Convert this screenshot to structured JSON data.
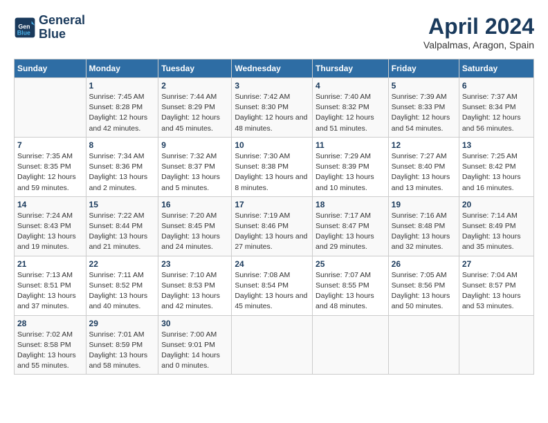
{
  "header": {
    "logo_line1": "General",
    "logo_line2": "Blue",
    "title": "April 2024",
    "subtitle": "Valpalmas, Aragon, Spain"
  },
  "columns": [
    "Sunday",
    "Monday",
    "Tuesday",
    "Wednesday",
    "Thursday",
    "Friday",
    "Saturday"
  ],
  "weeks": [
    [
      {
        "day": "",
        "sunrise": "",
        "sunset": "",
        "daylight": ""
      },
      {
        "day": "1",
        "sunrise": "Sunrise: 7:45 AM",
        "sunset": "Sunset: 8:28 PM",
        "daylight": "Daylight: 12 hours and 42 minutes."
      },
      {
        "day": "2",
        "sunrise": "Sunrise: 7:44 AM",
        "sunset": "Sunset: 8:29 PM",
        "daylight": "Daylight: 12 hours and 45 minutes."
      },
      {
        "day": "3",
        "sunrise": "Sunrise: 7:42 AM",
        "sunset": "Sunset: 8:30 PM",
        "daylight": "Daylight: 12 hours and 48 minutes."
      },
      {
        "day": "4",
        "sunrise": "Sunrise: 7:40 AM",
        "sunset": "Sunset: 8:32 PM",
        "daylight": "Daylight: 12 hours and 51 minutes."
      },
      {
        "day": "5",
        "sunrise": "Sunrise: 7:39 AM",
        "sunset": "Sunset: 8:33 PM",
        "daylight": "Daylight: 12 hours and 54 minutes."
      },
      {
        "day": "6",
        "sunrise": "Sunrise: 7:37 AM",
        "sunset": "Sunset: 8:34 PM",
        "daylight": "Daylight: 12 hours and 56 minutes."
      }
    ],
    [
      {
        "day": "7",
        "sunrise": "Sunrise: 7:35 AM",
        "sunset": "Sunset: 8:35 PM",
        "daylight": "Daylight: 12 hours and 59 minutes."
      },
      {
        "day": "8",
        "sunrise": "Sunrise: 7:34 AM",
        "sunset": "Sunset: 8:36 PM",
        "daylight": "Daylight: 13 hours and 2 minutes."
      },
      {
        "day": "9",
        "sunrise": "Sunrise: 7:32 AM",
        "sunset": "Sunset: 8:37 PM",
        "daylight": "Daylight: 13 hours and 5 minutes."
      },
      {
        "day": "10",
        "sunrise": "Sunrise: 7:30 AM",
        "sunset": "Sunset: 8:38 PM",
        "daylight": "Daylight: 13 hours and 8 minutes."
      },
      {
        "day": "11",
        "sunrise": "Sunrise: 7:29 AM",
        "sunset": "Sunset: 8:39 PM",
        "daylight": "Daylight: 13 hours and 10 minutes."
      },
      {
        "day": "12",
        "sunrise": "Sunrise: 7:27 AM",
        "sunset": "Sunset: 8:40 PM",
        "daylight": "Daylight: 13 hours and 13 minutes."
      },
      {
        "day": "13",
        "sunrise": "Sunrise: 7:25 AM",
        "sunset": "Sunset: 8:42 PM",
        "daylight": "Daylight: 13 hours and 16 minutes."
      }
    ],
    [
      {
        "day": "14",
        "sunrise": "Sunrise: 7:24 AM",
        "sunset": "Sunset: 8:43 PM",
        "daylight": "Daylight: 13 hours and 19 minutes."
      },
      {
        "day": "15",
        "sunrise": "Sunrise: 7:22 AM",
        "sunset": "Sunset: 8:44 PM",
        "daylight": "Daylight: 13 hours and 21 minutes."
      },
      {
        "day": "16",
        "sunrise": "Sunrise: 7:20 AM",
        "sunset": "Sunset: 8:45 PM",
        "daylight": "Daylight: 13 hours and 24 minutes."
      },
      {
        "day": "17",
        "sunrise": "Sunrise: 7:19 AM",
        "sunset": "Sunset: 8:46 PM",
        "daylight": "Daylight: 13 hours and 27 minutes."
      },
      {
        "day": "18",
        "sunrise": "Sunrise: 7:17 AM",
        "sunset": "Sunset: 8:47 PM",
        "daylight": "Daylight: 13 hours and 29 minutes."
      },
      {
        "day": "19",
        "sunrise": "Sunrise: 7:16 AM",
        "sunset": "Sunset: 8:48 PM",
        "daylight": "Daylight: 13 hours and 32 minutes."
      },
      {
        "day": "20",
        "sunrise": "Sunrise: 7:14 AM",
        "sunset": "Sunset: 8:49 PM",
        "daylight": "Daylight: 13 hours and 35 minutes."
      }
    ],
    [
      {
        "day": "21",
        "sunrise": "Sunrise: 7:13 AM",
        "sunset": "Sunset: 8:51 PM",
        "daylight": "Daylight: 13 hours and 37 minutes."
      },
      {
        "day": "22",
        "sunrise": "Sunrise: 7:11 AM",
        "sunset": "Sunset: 8:52 PM",
        "daylight": "Daylight: 13 hours and 40 minutes."
      },
      {
        "day": "23",
        "sunrise": "Sunrise: 7:10 AM",
        "sunset": "Sunset: 8:53 PM",
        "daylight": "Daylight: 13 hours and 42 minutes."
      },
      {
        "day": "24",
        "sunrise": "Sunrise: 7:08 AM",
        "sunset": "Sunset: 8:54 PM",
        "daylight": "Daylight: 13 hours and 45 minutes."
      },
      {
        "day": "25",
        "sunrise": "Sunrise: 7:07 AM",
        "sunset": "Sunset: 8:55 PM",
        "daylight": "Daylight: 13 hours and 48 minutes."
      },
      {
        "day": "26",
        "sunrise": "Sunrise: 7:05 AM",
        "sunset": "Sunset: 8:56 PM",
        "daylight": "Daylight: 13 hours and 50 minutes."
      },
      {
        "day": "27",
        "sunrise": "Sunrise: 7:04 AM",
        "sunset": "Sunset: 8:57 PM",
        "daylight": "Daylight: 13 hours and 53 minutes."
      }
    ],
    [
      {
        "day": "28",
        "sunrise": "Sunrise: 7:02 AM",
        "sunset": "Sunset: 8:58 PM",
        "daylight": "Daylight: 13 hours and 55 minutes."
      },
      {
        "day": "29",
        "sunrise": "Sunrise: 7:01 AM",
        "sunset": "Sunset: 8:59 PM",
        "daylight": "Daylight: 13 hours and 58 minutes."
      },
      {
        "day": "30",
        "sunrise": "Sunrise: 7:00 AM",
        "sunset": "Sunset: 9:01 PM",
        "daylight": "Daylight: 14 hours and 0 minutes."
      },
      {
        "day": "",
        "sunrise": "",
        "sunset": "",
        "daylight": ""
      },
      {
        "day": "",
        "sunrise": "",
        "sunset": "",
        "daylight": ""
      },
      {
        "day": "",
        "sunrise": "",
        "sunset": "",
        "daylight": ""
      },
      {
        "day": "",
        "sunrise": "",
        "sunset": "",
        "daylight": ""
      }
    ]
  ]
}
